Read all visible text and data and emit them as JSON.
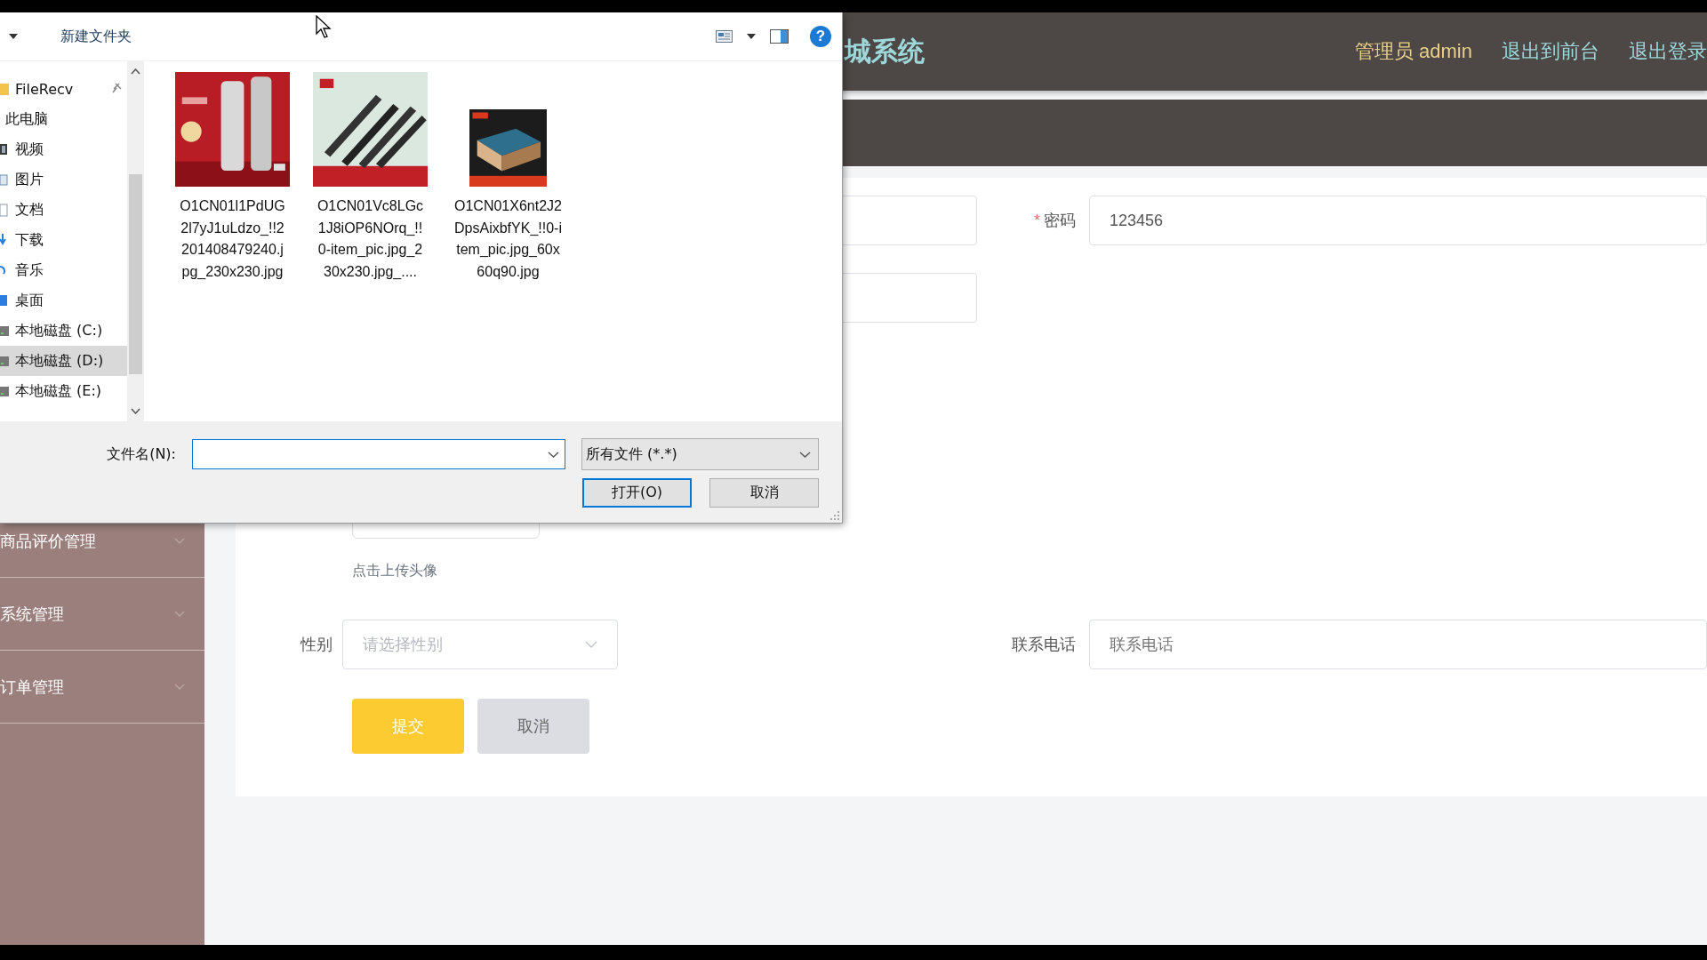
{
  "header": {
    "title": "城系统",
    "user": "管理员 admin",
    "links": [
      "退出到前台",
      "退出登录"
    ]
  },
  "sidebar": {
    "items": [
      {
        "label": "商品评价管理",
        "expanded": false
      },
      {
        "label": "系统管理",
        "expanded": false
      },
      {
        "label": "订单管理",
        "expanded": false
      }
    ]
  },
  "form": {
    "password": {
      "label": "密码",
      "required": true,
      "required_mark": "*",
      "value": "123456"
    },
    "avatar_hint": "点击上传头像",
    "gender": {
      "label": "性别",
      "placeholder": "请选择性别"
    },
    "phone": {
      "label": "联系电话",
      "placeholder": "联系电话"
    },
    "buttons": [
      {
        "label": "提交",
        "kind": "primary"
      },
      {
        "label": "取消",
        "kind": "default"
      }
    ]
  },
  "file_dialog": {
    "new_folder": "新建文件夹",
    "help": "?",
    "nav": [
      {
        "label": "FileRecv",
        "kind": "pinned-folder",
        "selected": false
      },
      {
        "label": "此电脑",
        "kind": "computer",
        "selected": false,
        "children": [
          {
            "label": "视频",
            "kind": "video",
            "selected": false
          },
          {
            "label": "图片",
            "kind": "pictures",
            "selected": false
          },
          {
            "label": "文档",
            "kind": "documents",
            "selected": false
          },
          {
            "label": "下载",
            "kind": "downloads",
            "selected": false
          },
          {
            "label": "音乐",
            "kind": "music",
            "selected": false
          },
          {
            "label": "桌面",
            "kind": "desktop",
            "selected": false
          },
          {
            "label": "本地磁盘 (C:)",
            "kind": "drive",
            "selected": false
          },
          {
            "label": "本地磁盘 (D:)",
            "kind": "drive",
            "selected": true
          },
          {
            "label": "本地磁盘 (E:)",
            "kind": "drive",
            "selected": false
          }
        ]
      }
    ],
    "files": [
      {
        "name": "O1CN01l1PdUG2l7yJ1uLdzo_!!2201408479240.jpg_230x230.jpg",
        "kind": "picture"
      },
      {
        "name": "O1CN01Vc8LGc1J8iOP6NOrq_!!0-item_pic.jpg_230x230.jpg_....",
        "kind": "picture"
      },
      {
        "name": "O1CN01X6nt2J2DpsAixbfYK_!!0-item_pic.jpg_60x60q90.jpg",
        "kind": "picture"
      }
    ],
    "filename_label": "文件名(N):",
    "file_type": "所有文件 (*.*)",
    "buttons": [
      {
        "label": "打开(O)",
        "default": true
      },
      {
        "label": "取消",
        "default": false
      }
    ]
  }
}
